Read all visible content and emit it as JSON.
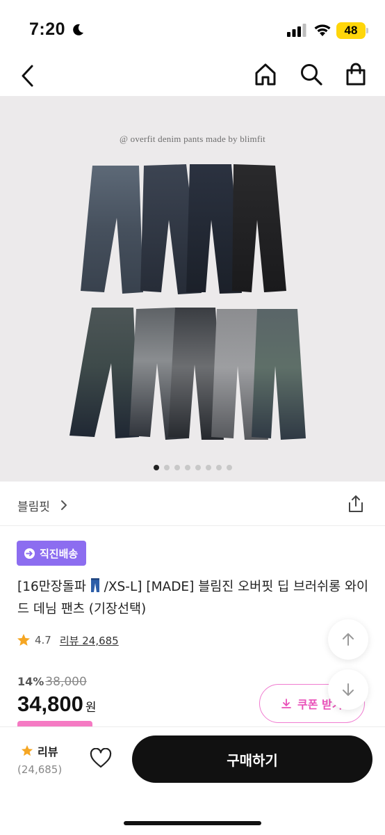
{
  "status_bar": {
    "time": "7:20",
    "battery": "48"
  },
  "nav": {
    "icons": [
      "back-icon",
      "home-icon",
      "search-icon",
      "shopping-bag-icon"
    ]
  },
  "product_image": {
    "caption": "@ overfit denim pants made by blimfit",
    "slide_count": 8,
    "active_slide": 1
  },
  "brand": {
    "name": "블림핏"
  },
  "badge": {
    "label": "직진배송"
  },
  "product": {
    "title_part1": "[16만장돌파",
    "title_part2": "/XS-L] [MADE] 블림진 오버핏 딥 브러쉬롱 와이드 데님 팬츠 (기장선택)",
    "rating": "4.7",
    "review_label": "리뷰 24,685"
  },
  "price": {
    "discount": "14%",
    "original": "38,000",
    "sale": "34,800",
    "currency": "원"
  },
  "coupon": {
    "label": "쿠폰 받기"
  },
  "bottom_bar": {
    "review_label": "리뷰",
    "review_count": "(24,685)",
    "buy_label": "구매하기"
  },
  "colors": {
    "badge": "#8c6df0",
    "coupon": "#e94fb8",
    "star": "#f5a623",
    "buy_button": "#111111"
  }
}
